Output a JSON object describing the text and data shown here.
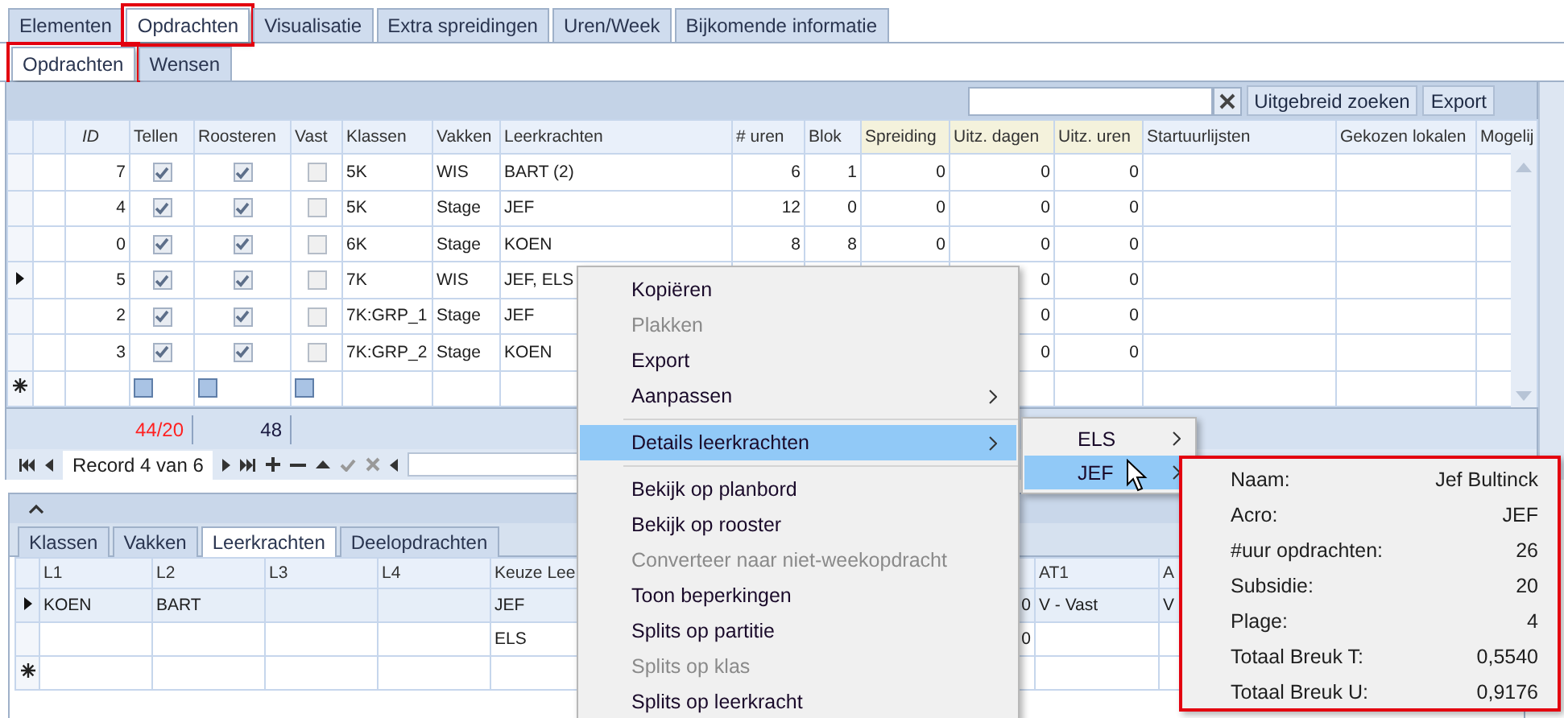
{
  "tabs": [
    {
      "label": "Elementen",
      "selected": false,
      "annotated": false
    },
    {
      "label": "Opdrachten",
      "selected": true,
      "annotated": true
    },
    {
      "label": "Visualisatie",
      "selected": false,
      "annotated": false
    },
    {
      "label": "Extra spreidingen",
      "selected": false,
      "annotated": false
    },
    {
      "label": "Uren/Week",
      "selected": false,
      "annotated": false
    },
    {
      "label": "Bijkomende informatie",
      "selected": false,
      "annotated": false
    }
  ],
  "subtabs": [
    {
      "label": "Opdrachten",
      "selected": true,
      "annotated": true
    },
    {
      "label": "Wensen",
      "selected": false,
      "annotated": false
    }
  ],
  "toolbar": {
    "buttons": [
      "Uitgebreid zoeken",
      "Export"
    ]
  },
  "grid": {
    "columns": [
      {
        "kind": "spacer"
      },
      {
        "label": "ID",
        "kind": "number",
        "italic": true,
        "tint": false
      },
      {
        "label": "Tellen",
        "kind": "check",
        "italic": false,
        "tint": false
      },
      {
        "label": "Roosteren",
        "kind": "check",
        "italic": false,
        "tint": false
      },
      {
        "label": "Vast",
        "kind": "check",
        "italic": false,
        "tint": false
      },
      {
        "label": "Klassen",
        "kind": "text",
        "italic": false,
        "tint": false
      },
      {
        "label": "Vakken",
        "kind": "text",
        "italic": false,
        "tint": false
      },
      {
        "label": "Leerkrachten",
        "kind": "text",
        "italic": false,
        "tint": false
      },
      {
        "label": "# uren",
        "kind": "number",
        "italic": false,
        "tint": false
      },
      {
        "label": "Blok",
        "kind": "number",
        "italic": false,
        "tint": false
      },
      {
        "label": "Spreiding",
        "kind": "number",
        "italic": false,
        "tint": true
      },
      {
        "label": "Uitz. dagen",
        "kind": "number",
        "italic": false,
        "tint": true
      },
      {
        "label": "Uitz. uren",
        "kind": "number",
        "italic": false,
        "tint": true
      },
      {
        "label": "Startuurlijsten",
        "kind": "text",
        "italic": false,
        "tint": false
      },
      {
        "label": "Gekozen lokalen",
        "kind": "text",
        "italic": false,
        "tint": false
      },
      {
        "label": "Mogelij",
        "kind": "text",
        "italic": false,
        "tint": false
      }
    ],
    "rows": [
      {
        "selected": false,
        "cells": [
          null,
          "7",
          true,
          true,
          false,
          "5K",
          "WIS",
          "BART (2)",
          "6",
          "1",
          "0",
          "0",
          "0",
          null,
          null,
          null
        ]
      },
      {
        "selected": false,
        "cells": [
          null,
          "4",
          true,
          true,
          false,
          "5K",
          "Stage",
          "JEF",
          "12",
          "0",
          "0",
          "0",
          "0",
          null,
          null,
          null
        ]
      },
      {
        "selected": false,
        "cells": [
          null,
          "0",
          true,
          true,
          false,
          "6K",
          "Stage",
          "KOEN",
          "8",
          "8",
          "0",
          "0",
          "0",
          null,
          null,
          null
        ]
      },
      {
        "selected": true,
        "cells": [
          null,
          "5",
          true,
          true,
          false,
          "7K",
          "WIS",
          "JEF, ELS",
          null,
          null,
          null,
          "0",
          "0",
          null,
          null,
          null
        ]
      },
      {
        "selected": false,
        "cells": [
          null,
          "2",
          true,
          true,
          false,
          "7K:GRP_1",
          "Stage",
          "JEF",
          null,
          null,
          null,
          "0",
          "0",
          null,
          null,
          null
        ]
      },
      {
        "selected": false,
        "cells": [
          null,
          "3",
          true,
          true,
          false,
          "7K:GRP_2",
          "Stage",
          "KOEN",
          null,
          null,
          null,
          "0",
          "0",
          null,
          null,
          null
        ]
      }
    ],
    "new_row": {
      "checks": [
        {
          "indeterminate": true
        },
        {
          "indeterminate": true
        },
        {
          "indeterminate": true
        }
      ]
    }
  },
  "summary": [
    {
      "text": "44/20",
      "color": "#ff2020"
    },
    {
      "text": "48",
      "color": "#1a1a40"
    }
  ],
  "navigator": {
    "record": "Record 4 van 6"
  },
  "lower": {
    "tabs": [
      {
        "label": "Klassen",
        "selected": false
      },
      {
        "label": "Vakken",
        "selected": false
      },
      {
        "label": "Leerkrachten",
        "selected": true
      },
      {
        "label": "Deelopdrachten",
        "selected": false
      }
    ],
    "columns": [
      "L1",
      "L2",
      "L3",
      "L4",
      "Keuze Lee",
      null,
      "AT1",
      "A"
    ],
    "rows": [
      {
        "selected": true,
        "cells": [
          "KOEN",
          "BART",
          null,
          null,
          "JEF",
          "0",
          "V - Vast",
          "V"
        ]
      },
      {
        "selected": false,
        "cells": [
          null,
          null,
          null,
          null,
          "ELS",
          "0",
          null,
          null
        ]
      }
    ]
  },
  "context_menu": [
    {
      "kind": "item",
      "label": "Kopiëren",
      "disabled": false,
      "submenu": false,
      "selected": false
    },
    {
      "kind": "item",
      "label": "Plakken",
      "disabled": true,
      "submenu": false,
      "selected": false
    },
    {
      "kind": "item",
      "label": "Export",
      "disabled": false,
      "submenu": false,
      "selected": false
    },
    {
      "kind": "item",
      "label": "Aanpassen",
      "disabled": false,
      "submenu": true,
      "selected": false
    },
    {
      "kind": "separator"
    },
    {
      "kind": "item",
      "label": "Details leerkrachten",
      "disabled": false,
      "submenu": true,
      "selected": true
    },
    {
      "kind": "separator"
    },
    {
      "kind": "item",
      "label": "Bekijk op planbord",
      "disabled": false,
      "submenu": false,
      "selected": false
    },
    {
      "kind": "item",
      "label": "Bekijk op rooster",
      "disabled": false,
      "submenu": false,
      "selected": false
    },
    {
      "kind": "item",
      "label": "Converteer naar niet-weekopdracht",
      "disabled": true,
      "submenu": false,
      "selected": false
    },
    {
      "kind": "item",
      "label": "Toon beperkingen",
      "disabled": false,
      "submenu": false,
      "selected": false
    },
    {
      "kind": "item",
      "label": "Splits op partitie",
      "disabled": false,
      "submenu": false,
      "selected": false
    },
    {
      "kind": "item",
      "label": "Splits op klas",
      "disabled": true,
      "submenu": false,
      "selected": false
    },
    {
      "kind": "item",
      "label": "Splits op leerkracht",
      "disabled": false,
      "submenu": false,
      "selected": false
    }
  ],
  "submenu": [
    {
      "label": "ELS",
      "submenu": true,
      "selected": false
    },
    {
      "label": "JEF",
      "submenu": true,
      "selected": true
    }
  ],
  "details": {
    "annotated": true,
    "rows": [
      {
        "label": "Naam:",
        "value": "Jef Bultinck"
      },
      {
        "label": "Acro:",
        "value": "JEF"
      },
      {
        "label": "#uur opdrachten:",
        "value": "26"
      },
      {
        "label": "Subsidie:",
        "value": "20"
      },
      {
        "label": "Plage:",
        "value": "4"
      },
      {
        "label": "Totaal Breuk T:",
        "value": "0,5540"
      },
      {
        "label": "Totaal Breuk U:",
        "value": "0,9176"
      }
    ]
  }
}
